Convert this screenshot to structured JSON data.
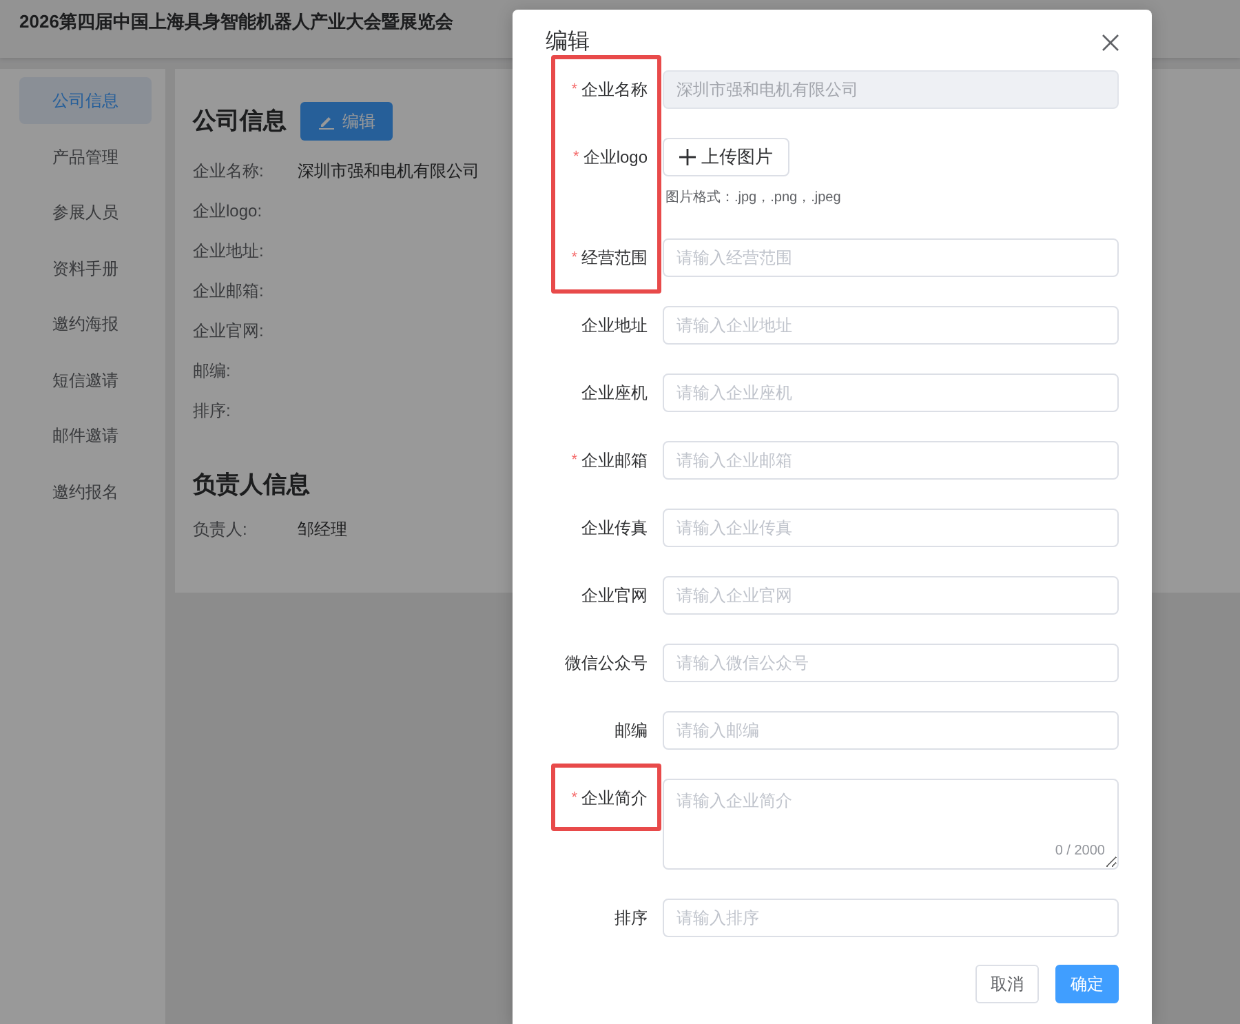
{
  "header": {
    "title": "2026第四届中国上海具身智能机器人产业大会暨展览会"
  },
  "sidebar": {
    "items": [
      {
        "label": "公司信息",
        "selected": true
      },
      {
        "label": "产品管理",
        "selected": false
      },
      {
        "label": "参展人员",
        "selected": false
      },
      {
        "label": "资料手册",
        "selected": false
      },
      {
        "label": "邀约海报",
        "selected": false
      },
      {
        "label": "短信邀请",
        "selected": false
      },
      {
        "label": "邮件邀请",
        "selected": false
      },
      {
        "label": "邀约报名",
        "selected": false
      }
    ]
  },
  "company_info": {
    "title": "公司信息",
    "edit_button": "编辑",
    "fields": [
      {
        "label": "企业名称:",
        "value": "深圳市强和电机有限公司"
      },
      {
        "label": "企业logo:"
      },
      {
        "label": "企业地址:"
      },
      {
        "label": "企业邮箱:"
      },
      {
        "label": "企业官网:"
      },
      {
        "label": "邮编:"
      },
      {
        "label": "排序:"
      }
    ]
  },
  "contact_info": {
    "title": "负责人信息",
    "fields": [
      {
        "label": "负责人:",
        "value": "邹经理"
      }
    ]
  },
  "dialog": {
    "title": "编辑",
    "fields": [
      {
        "kind": "input",
        "required": true,
        "required_mark": "*",
        "label": "企业名称",
        "disabled": true,
        "value": "深圳市强和电机有限公司",
        "highlighted": true
      },
      {
        "kind": "upload",
        "required": true,
        "required_mark": "*",
        "label": "企业logo",
        "button": "上传图片",
        "hint": "图片格式：.jpg，.png，.jpeg",
        "highlighted": true
      },
      {
        "kind": "input",
        "required": true,
        "required_mark": "*",
        "label": "经营范围",
        "disabled": false,
        "placeholder": "请输入经营范围",
        "highlighted": true
      },
      {
        "kind": "input",
        "required": false,
        "label": "企业地址",
        "disabled": false,
        "placeholder": "请输入企业地址",
        "highlighted": false
      },
      {
        "kind": "input",
        "required": false,
        "label": "企业座机",
        "disabled": false,
        "placeholder": "请输入企业座机",
        "highlighted": false
      },
      {
        "kind": "input",
        "required": true,
        "required_mark": "*",
        "label": "企业邮箱",
        "disabled": false,
        "placeholder": "请输入企业邮箱",
        "highlighted": false
      },
      {
        "kind": "input",
        "required": false,
        "label": "企业传真",
        "disabled": false,
        "placeholder": "请输入企业传真",
        "highlighted": false
      },
      {
        "kind": "input",
        "required": false,
        "label": "企业官网",
        "disabled": false,
        "placeholder": "请输入企业官网",
        "highlighted": false
      },
      {
        "kind": "input",
        "required": false,
        "label": "微信公众号",
        "disabled": false,
        "placeholder": "请输入微信公众号",
        "highlighted": false
      },
      {
        "kind": "input",
        "required": false,
        "label": "邮编",
        "disabled": false,
        "placeholder": "请输入邮编",
        "highlighted": false
      },
      {
        "kind": "textarea",
        "required": true,
        "required_mark": "*",
        "label": "企业简介",
        "placeholder": "请输入企业简介",
        "counter": "0 / 2000",
        "highlighted": true
      },
      {
        "kind": "input",
        "required": false,
        "label": "排序",
        "disabled": false,
        "placeholder": "请输入排序",
        "highlighted": false
      }
    ],
    "buttons": [
      {
        "label": "取消",
        "kind": "default"
      },
      {
        "label": "确定",
        "kind": "primary"
      }
    ]
  }
}
